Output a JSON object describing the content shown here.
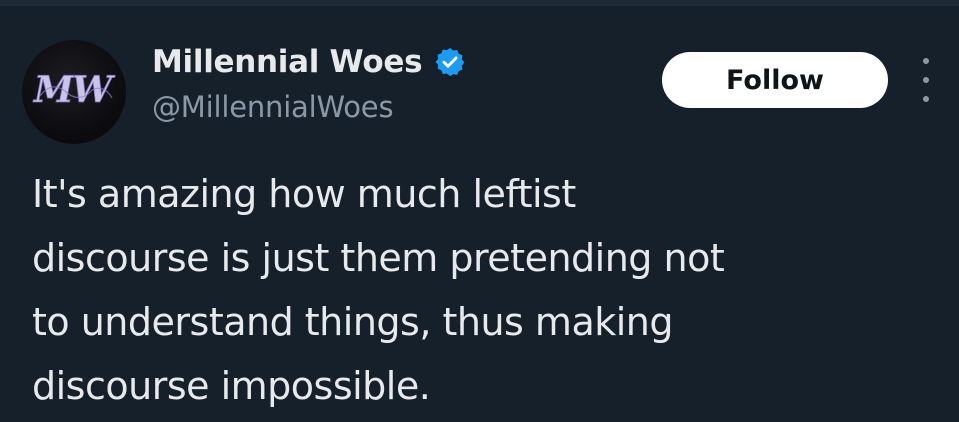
{
  "tweet": {
    "author": {
      "display_name": "Millennial Woes",
      "handle": "@MillennialWoes",
      "avatar_text": "MW",
      "verified": true
    },
    "follow_label": "Follow",
    "text_lines": [
      "It's amazing how much leftist",
      "discourse is just them pretending not",
      "to understand things, thus making",
      "discourse impossible."
    ]
  },
  "icons": {
    "verified": "verified-badge-icon",
    "more": "more-options-icon"
  },
  "colors": {
    "background": "#15202b",
    "text_primary": "#e7e9ea",
    "text_secondary": "#8b98a5",
    "verified_blue": "#1d9bf0",
    "follow_bg": "#ffffff",
    "follow_text": "#0f1419"
  }
}
